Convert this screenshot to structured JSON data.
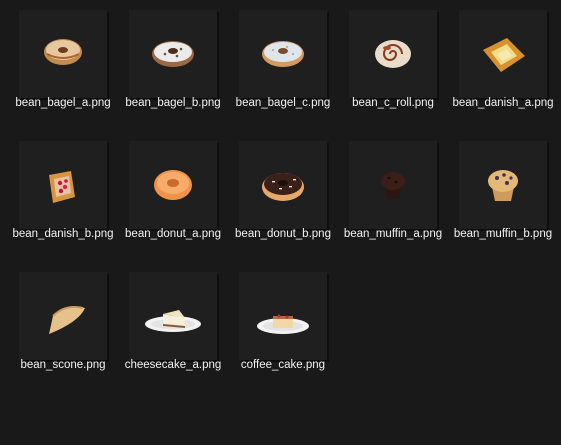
{
  "files": [
    {
      "name": "bean_bagel_a.png",
      "icon": "bagel-plain-icon"
    },
    {
      "name": "bean_bagel_b.png",
      "icon": "bagel-cream-cheese-icon"
    },
    {
      "name": "bean_bagel_c.png",
      "icon": "bagel-sesame-icon"
    },
    {
      "name": "bean_c_roll.png",
      "icon": "cinnamon-roll-icon"
    },
    {
      "name": "bean_danish_a.png",
      "icon": "danish-custard-icon"
    },
    {
      "name": "bean_danish_b.png",
      "icon": "danish-berry-icon"
    },
    {
      "name": "bean_donut_a.png",
      "icon": "donut-glazed-icon"
    },
    {
      "name": "bean_donut_b.png",
      "icon": "donut-chocolate-icon"
    },
    {
      "name": "bean_muffin_a.png",
      "icon": "muffin-chocolate-icon"
    },
    {
      "name": "bean_muffin_b.png",
      "icon": "muffin-blueberry-icon"
    },
    {
      "name": "bean_scone.png",
      "icon": "scone-icon"
    },
    {
      "name": "cheesecake_a.png",
      "icon": "cheesecake-icon"
    },
    {
      "name": "coffee_cake.png",
      "icon": "coffee-cake-icon"
    }
  ],
  "colors": {
    "background": "#191919",
    "text": "#f2f2f2"
  }
}
